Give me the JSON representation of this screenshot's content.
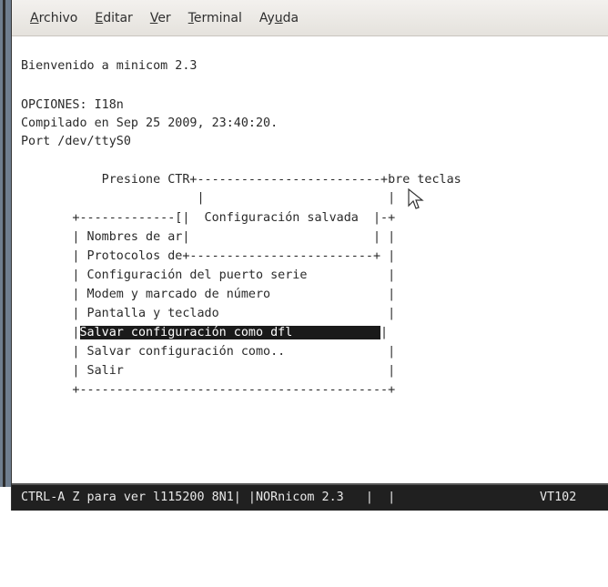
{
  "menubar": {
    "items": [
      {
        "mnemonic": "A",
        "rest": "rchivo"
      },
      {
        "mnemonic": "E",
        "rest": "ditar"
      },
      {
        "mnemonic": "V",
        "rest": "er"
      },
      {
        "mnemonic": "T",
        "rest": "erminal"
      },
      {
        "pre": "Ay",
        "mnemonic": "u",
        "rest": "da"
      }
    ]
  },
  "terminal": {
    "welcome": "Bienvenido a minicom 2.3",
    "options": "OPCIONES: I18n",
    "compiled": "Compilado en Sep 25 2009, 23:40:20.",
    "port": "Port /dev/ttyS0",
    "row_presione": "           Presione CTR+-------------------------+bre teclas",
    "row_blank1": "                        |                         |",
    "row_top_border": "       +-------------[|  Configuración salvada  |-+",
    "row_nombres": "       | Nombres de ar|                         | |",
    "row_protocolos": "       | Protocolos de+-------------------------+ |",
    "menu_config_puerto": "       | Configuración del puerto serie           |",
    "menu_modem": "       | Modem y marcado de número                |",
    "menu_pantalla": "       | Pantalla y teclado                       |",
    "row_highlight_prefix": "       |",
    "menu_salvar_dfl": "Salvar configuración como dfl            ",
    "row_highlight_suffix": "|",
    "menu_salvar_como": "       | Salvar configuración como..              |",
    "menu_salir": "       | Salir                                    |",
    "row_bottom_border": "       +------------------------------------------+"
  },
  "statusbar": {
    "left": "CTRL-A Z para ver l115200 8N1| |NORnicom 2.3   |  |",
    "right": "VT102"
  }
}
